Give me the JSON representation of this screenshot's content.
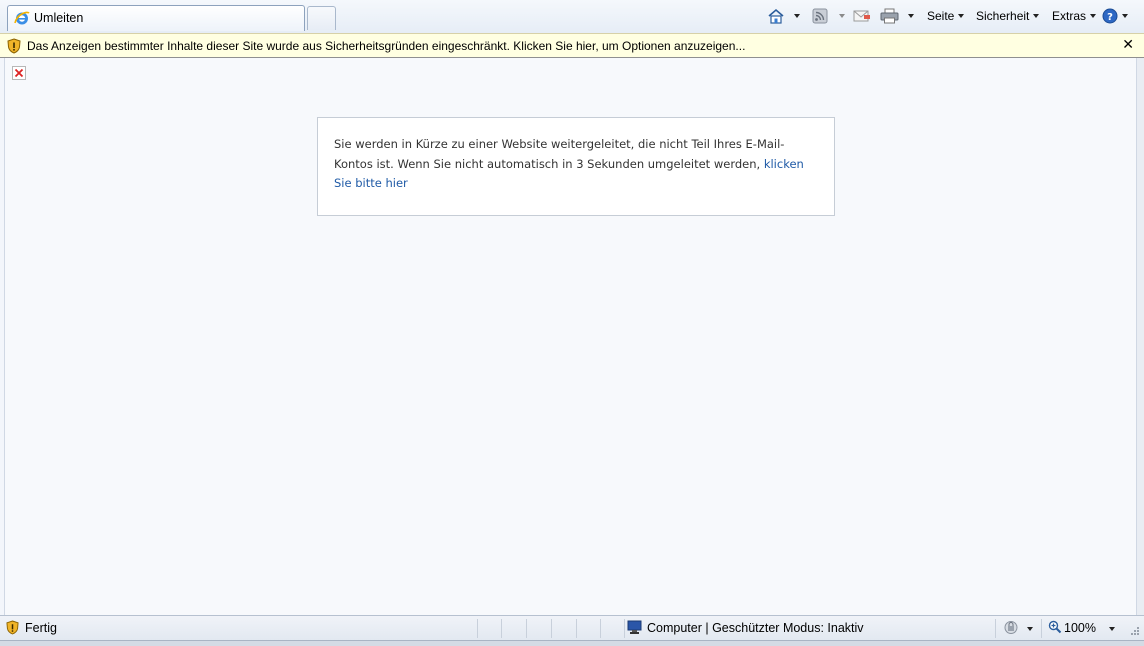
{
  "tab": {
    "title": "Umleiten",
    "icon": "ie-logo-icon"
  },
  "commandbar": {
    "page_label": "Seite",
    "security_label": "Sicherheit",
    "extras_label": "Extras"
  },
  "infobar": {
    "text": "Das Anzeigen bestimmter Inhalte dieser Site wurde aus Sicherheitsgründen eingeschränkt. Klicken Sie hier, um Optionen anzuzeigen...",
    "close": "✕"
  },
  "content": {
    "message": "Sie werden in Kürze zu einer Website weitergeleitet, die nicht Teil Ihres E-Mail-Kontos ist. Wenn Sie nicht automatisch in 3 Sekunden umgeleitet werden, ",
    "link": "klicken Sie bitte hier"
  },
  "statusbar": {
    "status": "Fertig",
    "zone": "Computer | Geschützter Modus: Inaktiv",
    "zoom": "100%"
  },
  "colors": {
    "link": "#1f5aa6",
    "infobar_bg": "#ffffe1"
  }
}
